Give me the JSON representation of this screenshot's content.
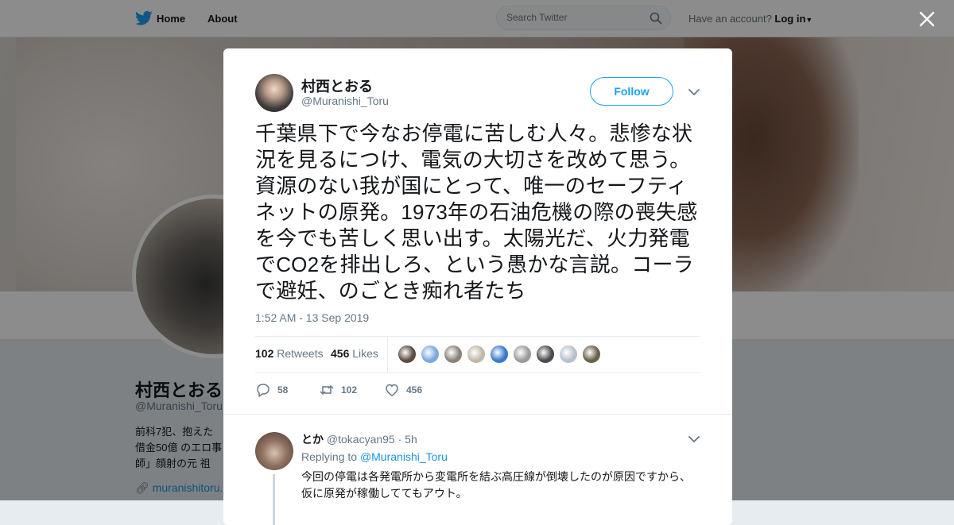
{
  "nav": {
    "home": "Home",
    "about": "About",
    "search_placeholder": "Search Twitter",
    "account_prompt": "Have an account?",
    "login": "Log in"
  },
  "profile": {
    "name": "村西とおる",
    "handle": "@Muranishi_Toru",
    "bio": "前科7犯、抱えた借金50億 のエロ事師」顔射の元 祖",
    "link": "muranishitoru."
  },
  "tweet": {
    "author_name": "村西とおる",
    "author_handle": "@Muranishi_Toru",
    "follow_label": "Follow",
    "text": "千葉県下で今なお停電に苦しむ人々。悲惨な状況を見るにつけ、電気の大切さを改めて思う。資源のない我が国にとって、唯一のセーフティネットの原発。1973年の石油危機の際の喪失感を今でも苦しく思い出す。太陽光だ、火力発電でCO2を排出しろ、という愚かな言説。コーラで避妊、のごとき痴れ者たち",
    "time": "1:52 AM - 13 Sep 2019",
    "retweets_count": "102",
    "retweets_label": "Retweets",
    "likes_count": "456",
    "likes_label": "Likes",
    "likers": [
      {
        "color": "#5a4a40"
      },
      {
        "color": "#7aa8e0"
      },
      {
        "color": "#8a8278"
      },
      {
        "color": "#c0b8a8"
      },
      {
        "color": "#3a78c8"
      },
      {
        "color": "#9a9a9a"
      },
      {
        "color": "#4a4a50"
      },
      {
        "color": "#b8c0cc"
      },
      {
        "color": "#6a6048"
      }
    ],
    "actions": {
      "reply_count": "58",
      "retweet_count": "102",
      "like_count": "456"
    }
  },
  "reply": {
    "name": "とか",
    "handle": "@tokacyan95",
    "time": "· 5h",
    "replying_to_label": "Replying to",
    "replying_to_handle": "@Muranishi_Toru",
    "text": "今回の停電は各発電所から変電所を結ぶ高圧線が倒壊したのが原因ですから、仮に原発が稼働しててもアウト。"
  },
  "colors": {
    "accent": "#1da1f2",
    "link": "#1b95e0",
    "text": "#14171a",
    "muted": "#657786"
  }
}
